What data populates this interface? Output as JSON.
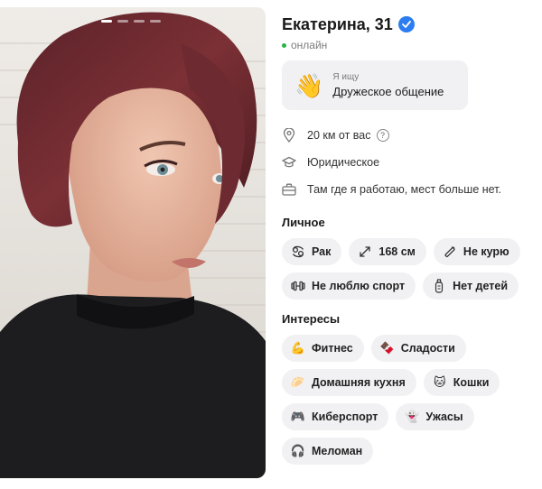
{
  "profile": {
    "name_age": "Екатерина, 31",
    "status": "онлайн",
    "looking_for": {
      "label": "Я ищу",
      "value": "Дружеское общение"
    },
    "facts": [
      {
        "icon": "location-pin-icon",
        "text": "20 км от вас"
      },
      {
        "icon": "graduation-cap-icon",
        "text": "Юридическое"
      },
      {
        "icon": "briefcase-icon",
        "text": "Там где я работаю, мест больше нет."
      }
    ]
  },
  "photo": {
    "count": 4,
    "active_index": 0
  },
  "personal": {
    "title": "Личное",
    "chips": [
      {
        "icon": "zodiac-icon",
        "label": "Рак"
      },
      {
        "icon": "height-arrows-icon",
        "label": "168 см"
      },
      {
        "icon": "cigarette-icon",
        "label": "Не курю"
      },
      {
        "icon": "dumbbell-icon",
        "label": "Не люблю спорт"
      },
      {
        "icon": "baby-bottle-icon",
        "label": "Нет детей"
      }
    ]
  },
  "interests": {
    "title": "Интересы",
    "chips": [
      {
        "icon": "flexed-biceps-icon",
        "emoji": "💪",
        "label": "Фитнес"
      },
      {
        "icon": "chocolate-icon",
        "emoji": "🍫",
        "label": "Сладости"
      },
      {
        "icon": "flatbread-icon",
        "emoji": "🥟",
        "label": "Домашняя кухня"
      },
      {
        "icon": "cat-face-icon",
        "emoji": "🐱",
        "label": "Кошки"
      },
      {
        "icon": "gamepad-icon",
        "emoji": "🎮",
        "label": "Киберспорт"
      },
      {
        "icon": "ghost-icon",
        "emoji": "👻",
        "label": "Ужасы"
      },
      {
        "icon": "headphones-icon",
        "emoji": "🎧",
        "label": "Меломан"
      }
    ]
  },
  "colors": {
    "accent": "#2b7df1",
    "online": "#2bb24c",
    "chip_bg": "#f1f1f3"
  }
}
